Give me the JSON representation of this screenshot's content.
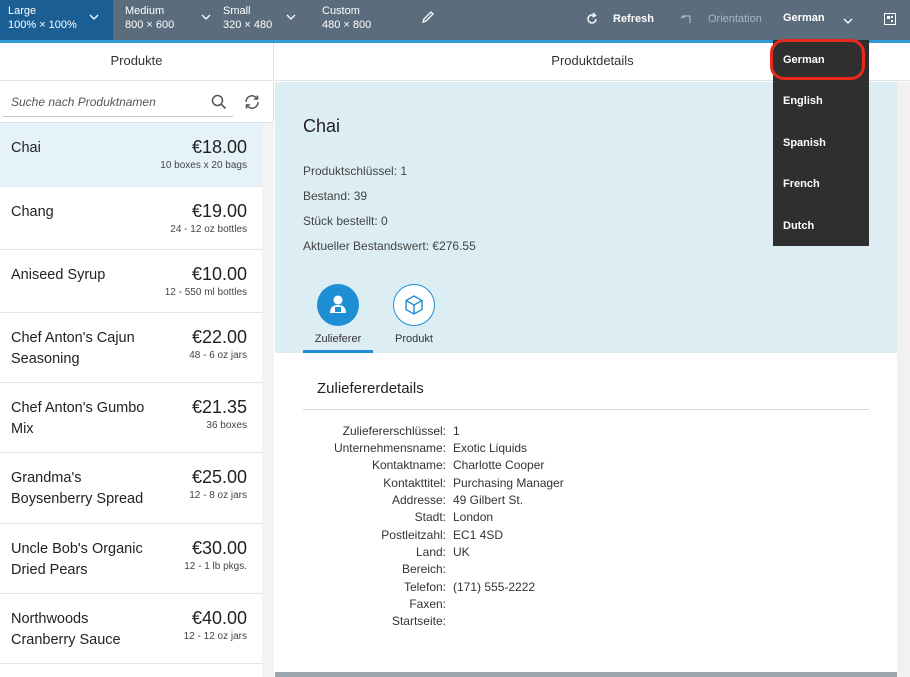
{
  "toolbar": {
    "devices": [
      {
        "label": "Large",
        "size": "100% × 100%",
        "active": true
      },
      {
        "label": "Medium",
        "size": "800 × 600",
        "active": false
      },
      {
        "label": "Small",
        "size": "320 × 480",
        "active": false
      },
      {
        "label": "Custom",
        "size": "480 × 800",
        "active": false
      }
    ],
    "refresh_label": "Refresh",
    "orientation_label": "Orientation",
    "language_selected": "German",
    "colors": {
      "bar": "#5b6d7d",
      "active": "#1a5e94",
      "accent": "#2e9bd6"
    }
  },
  "master": {
    "header": "Produkte",
    "search_placeholder": "Suche nach Produktnamen",
    "items": [
      {
        "name": "Chai",
        "price": "€18.00",
        "unit": "10 boxes x 20 bags"
      },
      {
        "name": "Chang",
        "price": "€19.00",
        "unit": "24 - 12 oz bottles"
      },
      {
        "name": "Aniseed Syrup",
        "price": "€10.00",
        "unit": "12 - 550 ml bottles"
      },
      {
        "name": "Chef Anton's Cajun Seasoning",
        "price": "€22.00",
        "unit": "48 - 6 oz jars"
      },
      {
        "name": "Chef Anton's Gumbo Mix",
        "price": "€21.35",
        "unit": "36 boxes"
      },
      {
        "name": "Grandma's Boysenberry Spread",
        "price": "€25.00",
        "unit": "12 - 8 oz jars"
      },
      {
        "name": "Uncle Bob's Organic Dried Pears",
        "price": "€30.00",
        "unit": "12 - 1 lb pkgs."
      },
      {
        "name": "Northwoods Cranberry Sauce",
        "price": "€40.00",
        "unit": "12 - 12 oz jars"
      }
    ]
  },
  "detail": {
    "header": "Produktdetails",
    "title": "Chai",
    "attributes": [
      "Produktschlüssel: 1",
      "Bestand: 39",
      "Stück bestellt: 0",
      "Aktueller Bestandswert: €276.55"
    ],
    "tabs": [
      {
        "label": "Zulieferer",
        "icon": "supplier-icon",
        "active": true
      },
      {
        "label": "Produkt",
        "icon": "product-box-icon",
        "active": false
      }
    ],
    "section_title": "Zuliefererdetails",
    "fields": [
      {
        "label": "Zuliefererschlüssel:",
        "value": "1"
      },
      {
        "label": "Unternehmensname:",
        "value": "Exotic Liquids"
      },
      {
        "label": "Kontaktname:",
        "value": "Charlotte Cooper"
      },
      {
        "label": "Kontakttitel:",
        "value": "Purchasing Manager"
      },
      {
        "label": "Addresse:",
        "value": "49 Gilbert St."
      },
      {
        "label": "Stadt:",
        "value": "London"
      },
      {
        "label": "Postleitzahl:",
        "value": "EC1 4SD"
      },
      {
        "label": "Land:",
        "value": "UK"
      },
      {
        "label": "Bereich:",
        "value": ""
      },
      {
        "label": "Telefon:",
        "value": "(171) 555-2222"
      },
      {
        "label": "Faxen:",
        "value": ""
      },
      {
        "label": "Startseite:",
        "value": ""
      }
    ]
  },
  "language_menu": {
    "options": [
      "German",
      "English",
      "Spanish",
      "French",
      "Dutch"
    ],
    "highlighted": "German",
    "highlight_color": "#e8291c"
  }
}
